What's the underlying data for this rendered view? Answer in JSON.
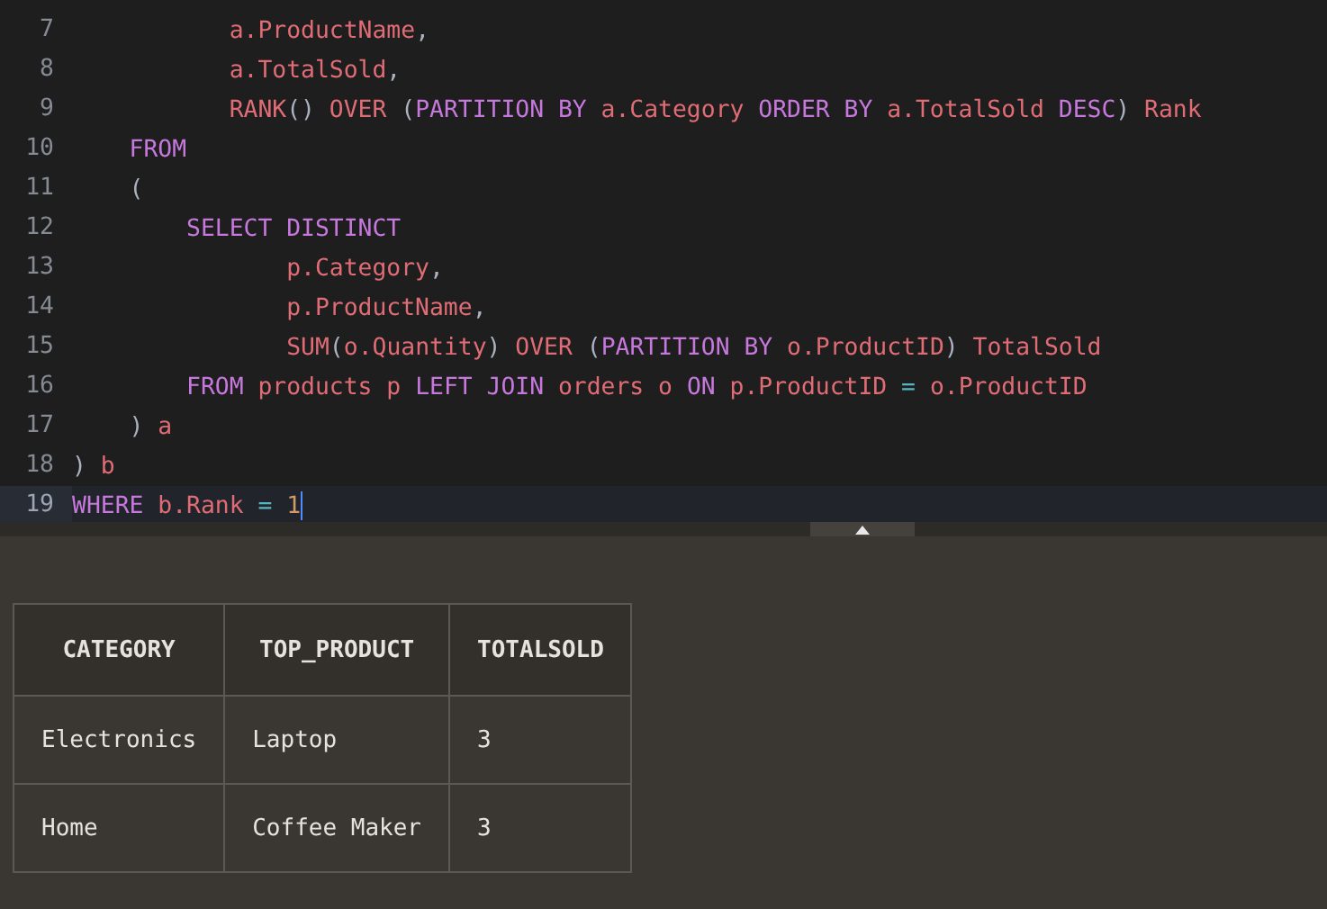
{
  "editor": {
    "lines": [
      {
        "number": "7",
        "current": false,
        "tokens": [
          {
            "kind": "id",
            "text": "           a.ProductName"
          },
          {
            "kind": "p",
            "text": ","
          }
        ]
      },
      {
        "number": "8",
        "current": false,
        "tokens": [
          {
            "kind": "id",
            "text": "           a.TotalSold"
          },
          {
            "kind": "p",
            "text": ","
          }
        ]
      },
      {
        "number": "9",
        "current": false,
        "tokens": [
          {
            "kind": "id",
            "text": "           RANK"
          },
          {
            "kind": "p",
            "text": "() "
          },
          {
            "kind": "id",
            "text": "OVER "
          },
          {
            "kind": "p",
            "text": "("
          },
          {
            "kind": "kw",
            "text": "PARTITION BY "
          },
          {
            "kind": "id",
            "text": "a.Category "
          },
          {
            "kind": "kw",
            "text": "ORDER BY "
          },
          {
            "kind": "id",
            "text": "a.TotalSold "
          },
          {
            "kind": "kw",
            "text": "DESC"
          },
          {
            "kind": "p",
            "text": ") "
          },
          {
            "kind": "id",
            "text": "Rank"
          }
        ]
      },
      {
        "number": "10",
        "current": false,
        "tokens": [
          {
            "kind": "kw",
            "text": "    FROM"
          }
        ]
      },
      {
        "number": "11",
        "current": false,
        "tokens": [
          {
            "kind": "p",
            "text": "    ("
          }
        ]
      },
      {
        "number": "12",
        "current": false,
        "tokens": [
          {
            "kind": "kw",
            "text": "        SELECT DISTINCT"
          }
        ]
      },
      {
        "number": "13",
        "current": false,
        "tokens": [
          {
            "kind": "id",
            "text": "               p.Category"
          },
          {
            "kind": "p",
            "text": ","
          }
        ]
      },
      {
        "number": "14",
        "current": false,
        "tokens": [
          {
            "kind": "id",
            "text": "               p.ProductName"
          },
          {
            "kind": "p",
            "text": ","
          }
        ]
      },
      {
        "number": "15",
        "current": false,
        "tokens": [
          {
            "kind": "id",
            "text": "               SUM"
          },
          {
            "kind": "p",
            "text": "("
          },
          {
            "kind": "id",
            "text": "o.Quantity"
          },
          {
            "kind": "p",
            "text": ") "
          },
          {
            "kind": "id",
            "text": "OVER "
          },
          {
            "kind": "p",
            "text": "("
          },
          {
            "kind": "kw",
            "text": "PARTITION BY "
          },
          {
            "kind": "id",
            "text": "o.ProductID"
          },
          {
            "kind": "p",
            "text": ") "
          },
          {
            "kind": "id",
            "text": "TotalSold"
          }
        ]
      },
      {
        "number": "16",
        "current": false,
        "tokens": [
          {
            "kind": "kw",
            "text": "        FROM "
          },
          {
            "kind": "id",
            "text": "products p "
          },
          {
            "kind": "kw",
            "text": "LEFT JOIN "
          },
          {
            "kind": "id",
            "text": "orders o "
          },
          {
            "kind": "kw",
            "text": "ON "
          },
          {
            "kind": "id",
            "text": "p.ProductID "
          },
          {
            "kind": "op",
            "text": "= "
          },
          {
            "kind": "id",
            "text": "o.ProductID"
          }
        ]
      },
      {
        "number": "17",
        "current": false,
        "tokens": [
          {
            "kind": "p",
            "text": "    ) "
          },
          {
            "kind": "id",
            "text": "a"
          }
        ]
      },
      {
        "number": "18",
        "current": false,
        "tokens": [
          {
            "kind": "p",
            "text": ") "
          },
          {
            "kind": "id",
            "text": "b"
          }
        ]
      },
      {
        "number": "19",
        "current": true,
        "tokens": [
          {
            "kind": "kw",
            "text": "WHERE "
          },
          {
            "kind": "id",
            "text": "b.Rank "
          },
          {
            "kind": "op",
            "text": "= "
          },
          {
            "kind": "num",
            "text": "1"
          }
        ]
      }
    ]
  },
  "results": {
    "columns": [
      "CATEGORY",
      "TOP_PRODUCT",
      "TOTALSOLD"
    ],
    "rows": [
      [
        "Electronics",
        "Laptop",
        "3"
      ],
      [
        "Home",
        "Coffee Maker",
        "3"
      ]
    ]
  }
}
